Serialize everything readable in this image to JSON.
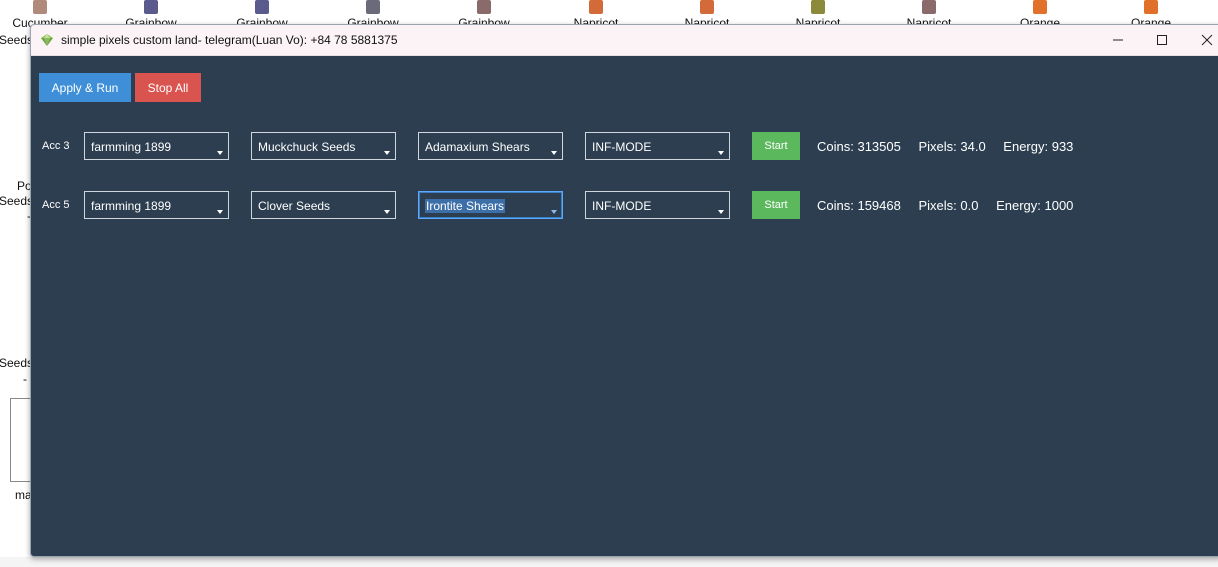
{
  "desktop": {
    "icons": [
      {
        "label": "Cucumber",
        "color": "#b08a7a"
      },
      {
        "label": "Grainbow",
        "color": "#5a5a8c"
      },
      {
        "label": "Grainbow",
        "color": "#5a5a8c"
      },
      {
        "label": "Grainbow",
        "color": "#6a6a7a"
      },
      {
        "label": "Grainbow",
        "color": "#8a6a6a"
      },
      {
        "label": "Napricot",
        "color": "#d26a3a"
      },
      {
        "label": "Napricot",
        "color": "#d26a3a"
      },
      {
        "label": "Napricot",
        "color": "#8a8a3a"
      },
      {
        "label": "Napricot",
        "color": "#8a6a6a"
      },
      {
        "label": "Orange",
        "color": "#e0702a"
      },
      {
        "label": "Orange",
        "color": "#e0702a"
      }
    ],
    "left_labels": [
      "Seeds_",
      "Po",
      "Seeds_",
      "-",
      "Seeds_",
      "-",
      "ma"
    ]
  },
  "window": {
    "title": "simple pixels custom land- telegram(Luan Vo): +84 78 5881375",
    "icon": "gem-icon",
    "controls": {
      "minimize": "minimize-icon",
      "maximize": "maximize-icon",
      "close": "close-icon"
    }
  },
  "toolbar": {
    "apply_label": "Apply & Run",
    "stop_label": "Stop All"
  },
  "accounts": [
    {
      "label": "Acc 3",
      "farm": "farmming 1899",
      "seed": "Muckchuck Seeds",
      "shears": "Adamaxium Shears",
      "mode": "INF-MODE",
      "start_label": "Start",
      "coins": "Coins: 313505",
      "pixels": "Pixels: 34.0",
      "energy": "Energy: 933"
    },
    {
      "label": "Acc 5",
      "farm": "farmming 1899",
      "seed": "Clover Seeds",
      "shears": "Irontite Shears",
      "mode": "INF-MODE",
      "start_label": "Start",
      "coins": "Coins: 159468",
      "pixels": "Pixels: 0.0",
      "energy": "Energy: 1000"
    }
  ],
  "colors": {
    "background": "#2c3e50",
    "apply": "#3e8fd8",
    "stop": "#d9534f",
    "start": "#5cb85c"
  }
}
